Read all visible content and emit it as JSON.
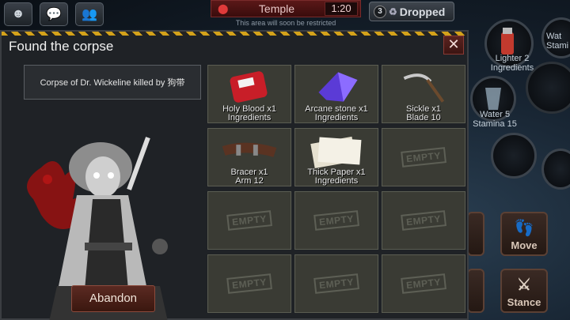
{
  "location": {
    "name": "Temple",
    "timer": "1:20",
    "note": "This area will soon be restricted"
  },
  "dropped": {
    "count": "3",
    "label": "Dropped"
  },
  "right_hud": {
    "items": [
      {
        "name": "Lighter",
        "count": "2",
        "type": "Ingredients"
      },
      {
        "name": "Water",
        "count": "5",
        "type": "Stamina 15"
      }
    ],
    "partial_label_top": "Wat\nStami",
    "actions": [
      {
        "label": "Move"
      },
      {
        "label": "Stance"
      }
    ]
  },
  "dialog": {
    "title": "Found the corpse",
    "corpse_label": "Corpse of Dr. Wickeline killed by 狗带",
    "abandon_label": "Abandon",
    "close_icon": "✕"
  },
  "loot": [
    {
      "name": "Holy Blood x1",
      "type": "Ingredients",
      "icon": "blood-bag-icon"
    },
    {
      "name": "Arcane stone x1",
      "type": "Ingredients",
      "icon": "arcane-stone-icon"
    },
    {
      "name": "Sickle x1",
      "type": "Blade 10",
      "icon": "sickle-icon"
    },
    {
      "name": "Bracer x1",
      "type": "Arm 12",
      "icon": "bracer-icon"
    },
    {
      "name": "Thick Paper x1",
      "type": "Ingredients",
      "icon": "paper-icon"
    },
    {
      "empty_label": "EMPTY"
    }
  ],
  "empty_label": "EMPTY"
}
